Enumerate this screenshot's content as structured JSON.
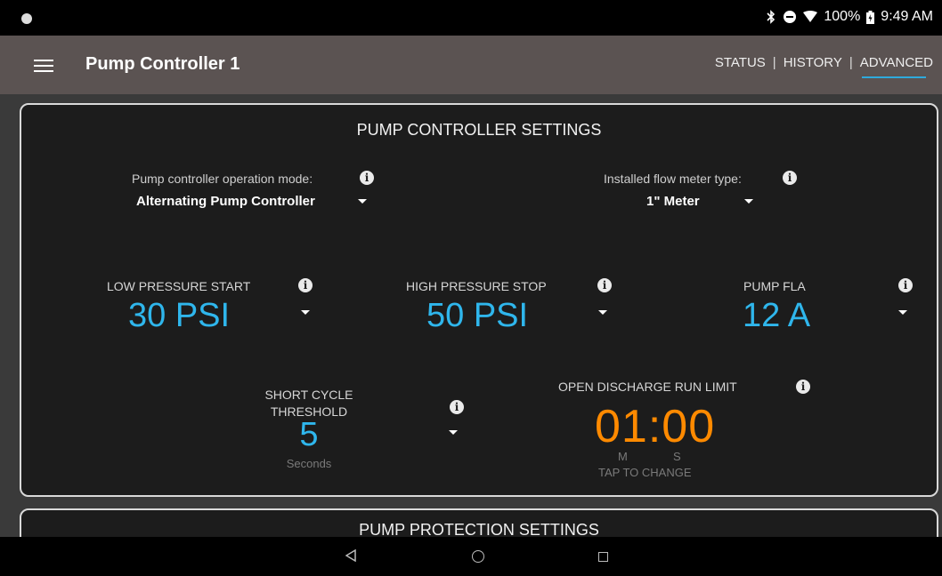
{
  "statusbar": {
    "battery": "100%",
    "time": "9:49 AM"
  },
  "appbar": {
    "title": "Pump Controller 1",
    "tabs": [
      {
        "label": "STATUS",
        "active": false
      },
      {
        "label": "HISTORY",
        "active": false
      },
      {
        "label": "ADVANCED",
        "active": true
      }
    ],
    "separator": "|"
  },
  "controller_settings": {
    "title": "PUMP CONTROLLER SETTINGS",
    "operation_mode": {
      "label": "Pump controller operation mode:",
      "value": "Alternating Pump Controller"
    },
    "flow_meter": {
      "label": "Installed flow meter type:",
      "value": "1\" Meter"
    },
    "low_pressure_start": {
      "label": "LOW PRESSURE START",
      "value": "30 PSI"
    },
    "high_pressure_stop": {
      "label": "HIGH PRESSURE STOP",
      "value": "50 PSI"
    },
    "pump_fla": {
      "label": "PUMP FLA",
      "value": "12 A"
    },
    "short_cycle": {
      "label_line1": "SHORT CYCLE",
      "label_line2": "THRESHOLD",
      "value": "5",
      "unit": "Seconds"
    },
    "open_discharge": {
      "label": "OPEN DISCHARGE RUN LIMIT",
      "value": "01:00",
      "min_label": "M",
      "sec_label": "S",
      "hint": "TAP TO CHANGE"
    }
  },
  "protection_settings": {
    "title": "PUMP PROTECTION SETTINGS"
  },
  "info_glyph": "i",
  "colors": {
    "accent_blue": "#2fb6ec",
    "accent_orange": "#ff8a00",
    "appbar": "#5b5352"
  }
}
